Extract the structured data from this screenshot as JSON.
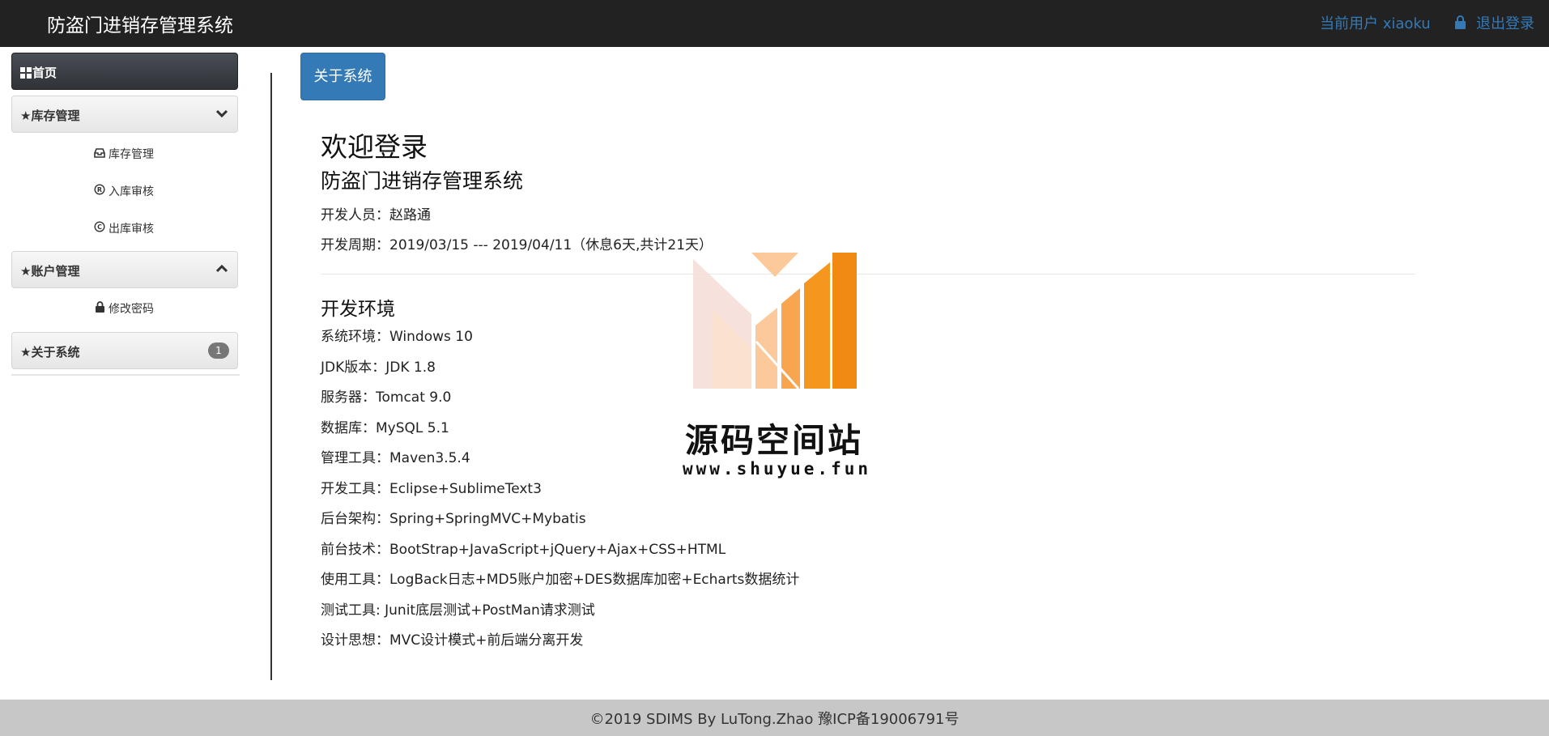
{
  "header": {
    "title": "防盗门进销存管理系统",
    "current_user": "当前用户 xiaoku",
    "logout_label": "退出登录",
    "logout_icon": "lock-icon"
  },
  "sidebar": {
    "home": {
      "label": "首页",
      "icon": "grid-icon"
    },
    "inventory": {
      "label": "★库存管理",
      "chevron": "chevron-down-icon",
      "items": [
        {
          "label": "库存管理",
          "icon": "inbox-icon"
        },
        {
          "label": "入库审核",
          "icon": "registered-icon"
        },
        {
          "label": "出库审核",
          "icon": "copyright-icon"
        }
      ]
    },
    "account": {
      "label": "★账户管理",
      "chevron": "chevron-up-icon",
      "items": [
        {
          "label": "修改密码",
          "icon": "lock-icon"
        }
      ]
    },
    "about": {
      "label": "★关于系统",
      "badge": "1"
    }
  },
  "main": {
    "about_button": "关于系统",
    "welcome": "欢迎登录",
    "system_name": "防盗门进销存管理系统",
    "developer": "开发人员：赵路通",
    "period": "开发周期：2019/03/15 --- 2019/04/11（休息6天,共计21天）",
    "env_title": "开发环境",
    "env": [
      "系统环境：Windows 10",
      "JDK版本：JDK 1.8",
      "服务器：Tomcat 9.0",
      "数据库：MySQL 5.1",
      "管理工具：Maven3.5.4",
      "开发工具：Eclipse+SublimeText3",
      "后台架构：Spring+SpringMVC+Mybatis",
      "前台技术：BootStrap+JavaScript+jQuery+Ajax+CSS+HTML",
      "使用工具：LogBack日志+MD5账户加密+DES数据库加密+Echarts数据统计",
      "测试工具: Junit底层测试+PostMan请求测试",
      "设计思想：MVC设计模式+前后端分离开发"
    ]
  },
  "watermark": {
    "title": "源码空间站",
    "url": "www.shuyue.fun",
    "colors": [
      "#f6dcd6",
      "#fbc99a",
      "#f7a64f",
      "#f18a12"
    ]
  },
  "footer": {
    "text": "©2019 SDIMS By LuTong.Zhao 豫ICP备19006791号"
  },
  "colors": {
    "navbar": "#222222",
    "link": "#337ab7",
    "button": "#337ab7",
    "footer": "#c7c7c7"
  }
}
